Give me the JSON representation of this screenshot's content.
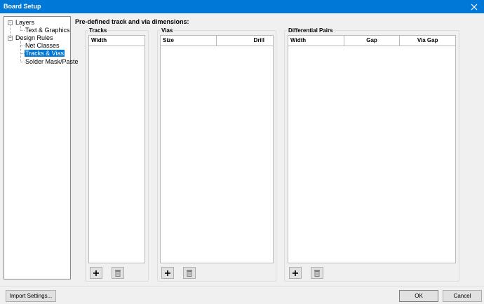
{
  "window": {
    "title": "Board Setup",
    "close_icon": "close-icon"
  },
  "tree": {
    "items": [
      {
        "label": "Layers",
        "expanded": true
      },
      {
        "label": "Text & Graphics"
      },
      {
        "label": "Design Rules",
        "expanded": true
      },
      {
        "label": "Net Classes"
      },
      {
        "label": "Tracks & Vias",
        "selected": true
      },
      {
        "label": "Solder Mask/Paste"
      }
    ]
  },
  "main": {
    "heading": "Pre-defined track and via dimensions:",
    "tracks": {
      "label": "Tracks",
      "columns": [
        "Width"
      ],
      "rows": []
    },
    "vias": {
      "label": "Vias",
      "columns": [
        "Size",
        "Drill"
      ],
      "rows": []
    },
    "diff_pairs": {
      "label": "Differential Pairs",
      "columns": [
        "Width",
        "Gap",
        "Via Gap"
      ],
      "rows": []
    }
  },
  "footer": {
    "import_label": "Import Settings...",
    "ok_label": "OK",
    "cancel_label": "Cancel"
  },
  "colors": {
    "accent": "#0078d7",
    "window_bg": "#f0f0f0"
  }
}
